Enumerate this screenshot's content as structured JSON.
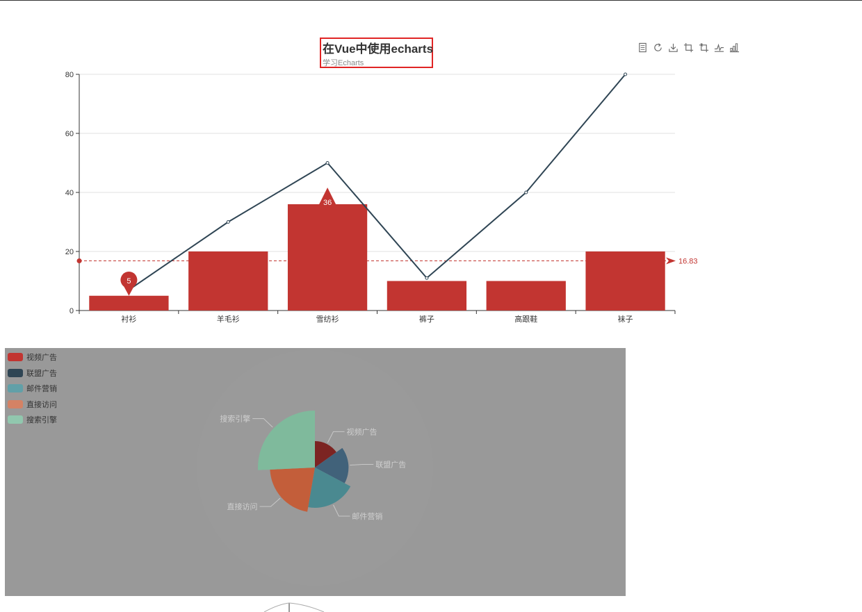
{
  "header": {
    "title": "在Vue中使用echarts",
    "subtitle": "学习Echarts"
  },
  "toolbox": [
    {
      "name": "data-view-icon"
    },
    {
      "name": "restore-icon"
    },
    {
      "name": "save-image-icon"
    },
    {
      "name": "data-zoom-icon"
    },
    {
      "name": "zoom-reset-icon"
    },
    {
      "name": "line-chart-icon"
    },
    {
      "name": "bar-chart-icon"
    }
  ],
  "colors": {
    "bar": "#c23531",
    "line": "#2f4554",
    "pie_legend": [
      "#c23531",
      "#2f4554",
      "#61a0a8",
      "#d48265",
      "#91c7ae"
    ],
    "pie_slices": [
      "#7c2422",
      "#41627a",
      "#4a8990",
      "#c35e3a",
      "#7fba9c"
    ],
    "panel_bg": "#999999"
  },
  "chart_data": [
    {
      "type": "bar",
      "categories": [
        "衬衫",
        "羊毛衫",
        "雪纺衫",
        "裤子",
        "高跟鞋",
        "袜子"
      ],
      "y_ticks": [
        "0",
        "20",
        "40",
        "60",
        "80"
      ],
      "ylim": [
        0,
        80
      ],
      "grid": true,
      "series": [
        {
          "type": "bar",
          "values": [
            5,
            20,
            36,
            10,
            10,
            20
          ]
        },
        {
          "type": "line",
          "values": [
            7,
            30,
            50,
            11,
            40,
            80
          ]
        }
      ],
      "mark_points": [
        {
          "label": "5",
          "index": 0,
          "value": 5
        },
        {
          "label": "36",
          "index": 2,
          "value": 36
        }
      ],
      "mark_line": {
        "label": "16.83",
        "value": 16.83
      }
    },
    {
      "type": "pie",
      "legend": [
        "视频广告",
        "联盟广告",
        "邮件营销",
        "直接访问",
        "搜索引擎"
      ],
      "slices": [
        {
          "name": "视频广告",
          "value": 235
        },
        {
          "name": "联盟广告",
          "value": 274
        },
        {
          "name": "邮件营销",
          "value": 310
        },
        {
          "name": "直接访问",
          "value": 335
        },
        {
          "name": "搜索引擎",
          "value": 400
        }
      ],
      "legend_placement": "top-left"
    }
  ]
}
